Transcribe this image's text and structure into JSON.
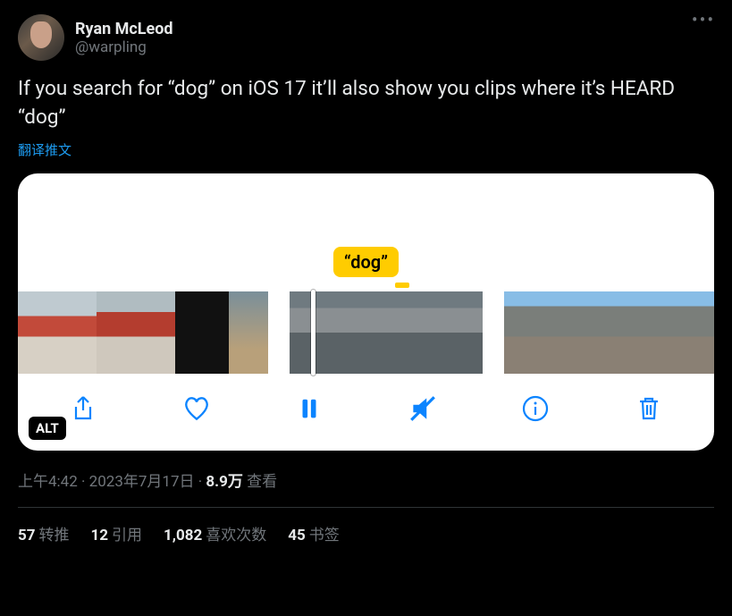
{
  "user": {
    "display_name": "Ryan McLeod",
    "handle": "@warpling"
  },
  "body": "If you search for “dog” on iOS 17 it’ll also show you clips where it’s HEARD “dog”",
  "translate_label": "翻译推文",
  "card": {
    "bubble": "“dog”",
    "alt_badge": "ALT"
  },
  "meta": {
    "time": "上午4:42",
    "separator": " · ",
    "date": "2023年7月17日",
    "views_count": "8.9万",
    "views_label": " 查看"
  },
  "stats": {
    "retweets": {
      "count": "57",
      "label": "转推"
    },
    "quotes": {
      "count": "12",
      "label": "引用"
    },
    "likes": {
      "count": "1,082",
      "label": "喜欢次数"
    },
    "bookmarks": {
      "count": "45",
      "label": "书签"
    }
  }
}
